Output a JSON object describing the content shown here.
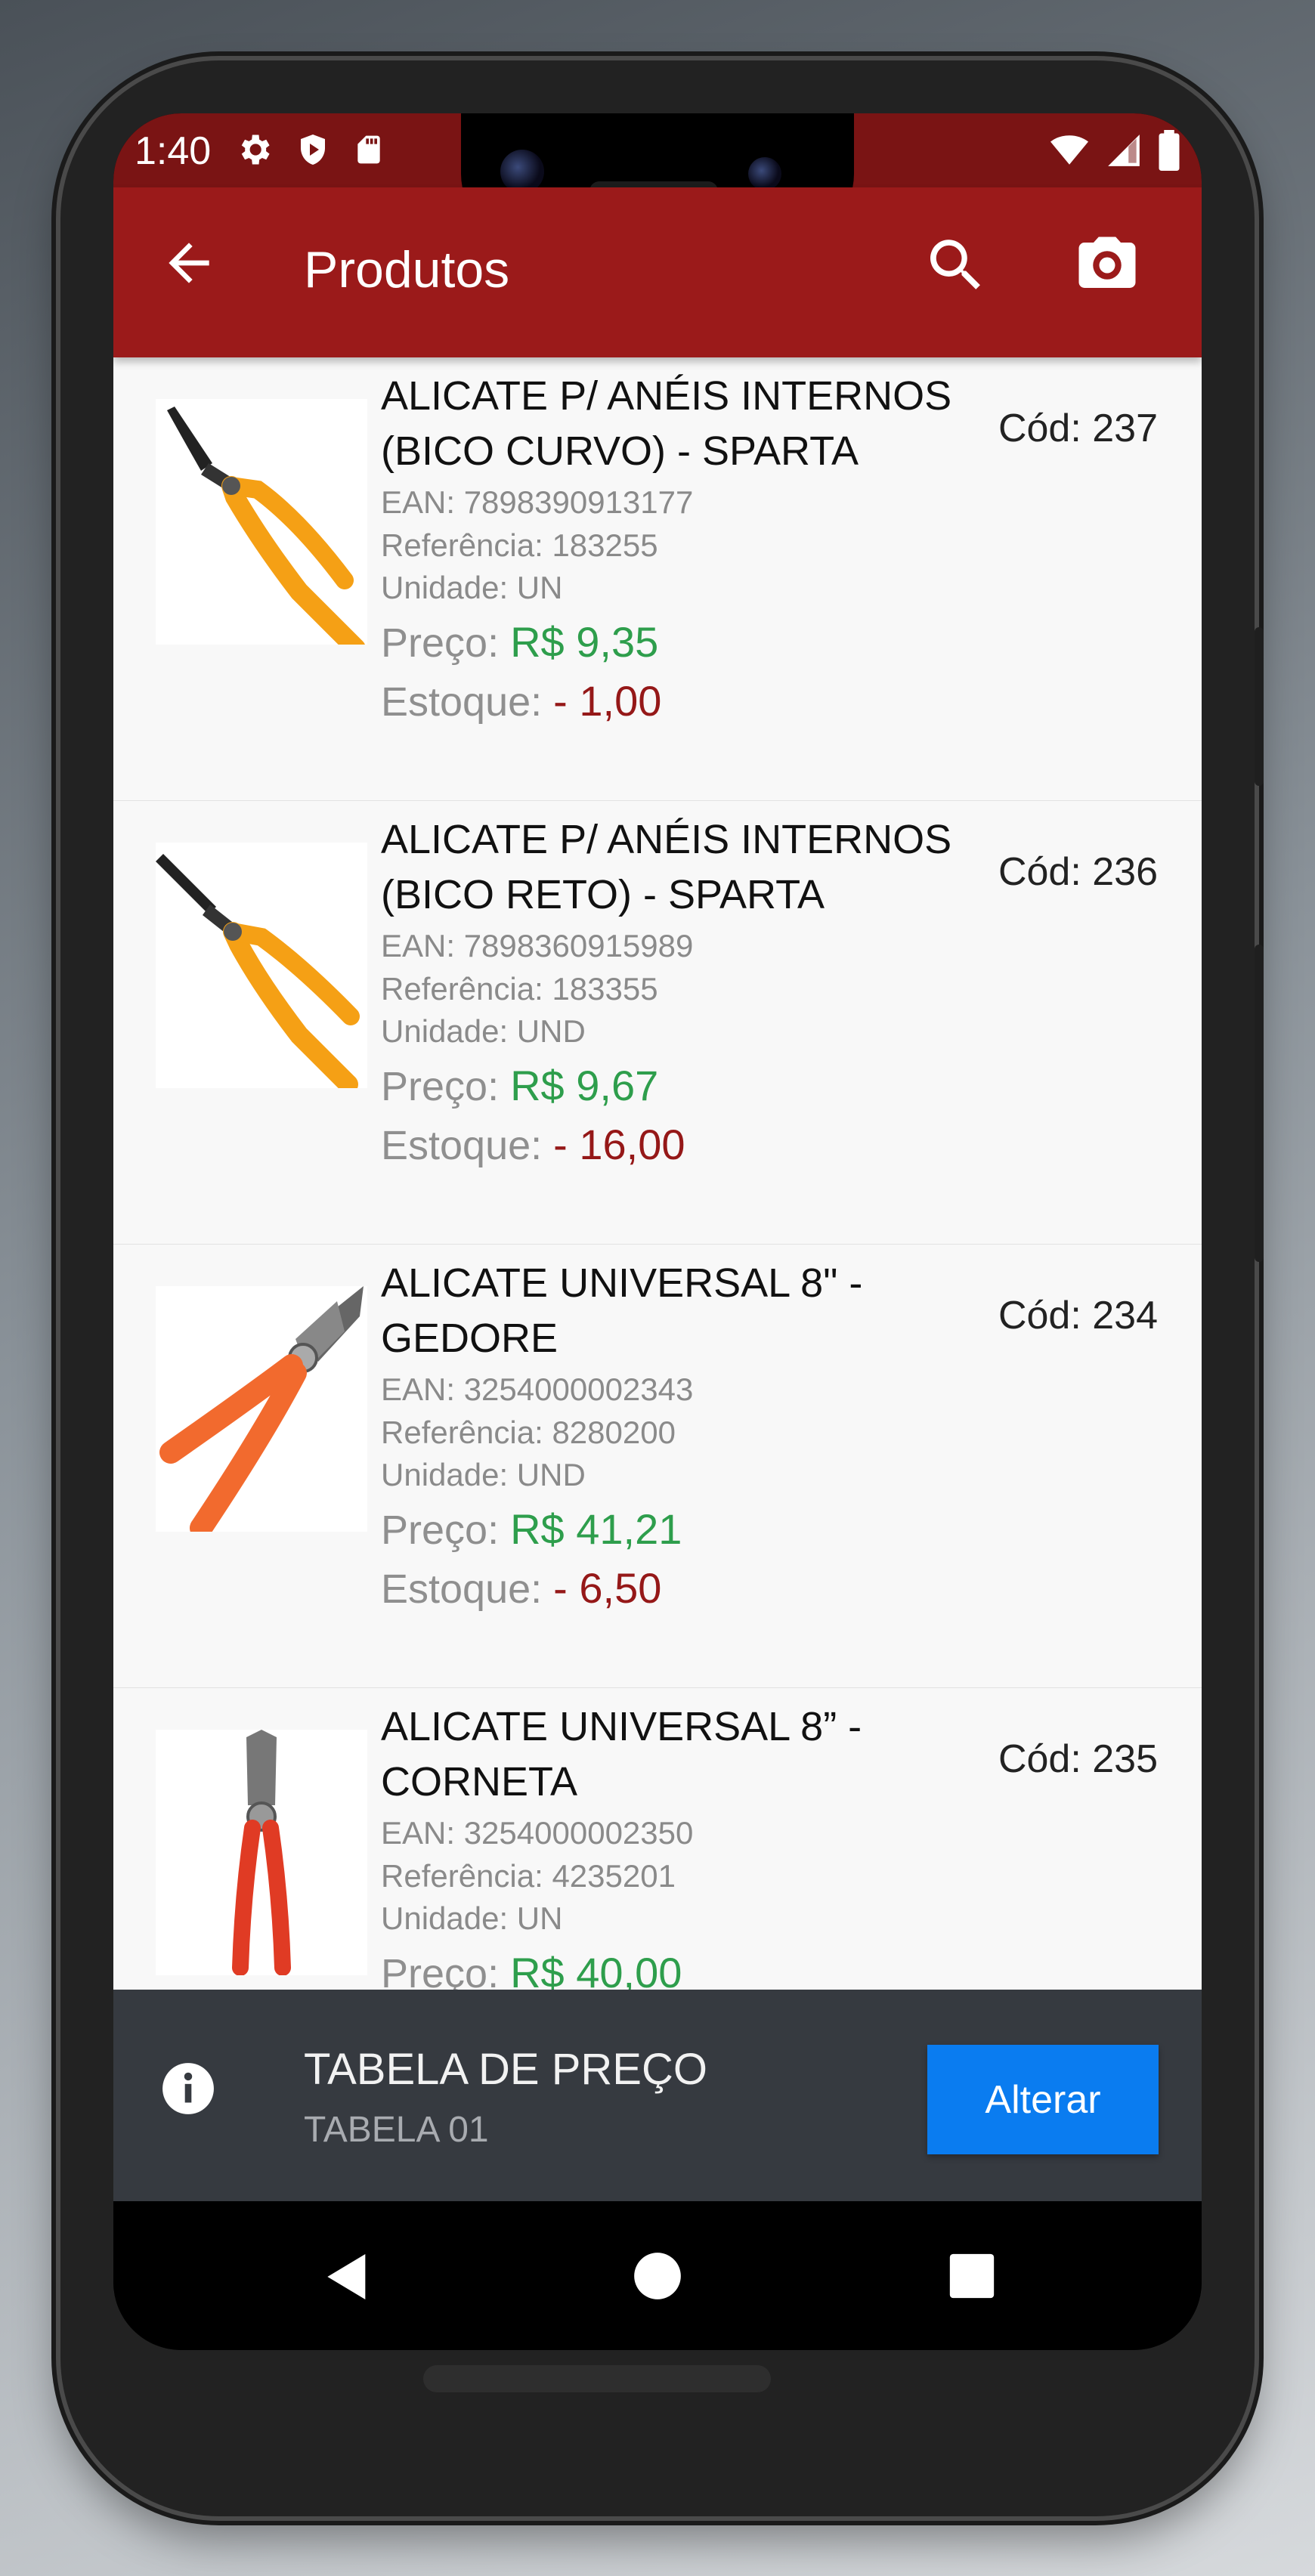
{
  "status_bar": {
    "time": "1:40"
  },
  "app_bar": {
    "title": "Produtos"
  },
  "products": [
    {
      "name": "ALICATE P/ ANÉIS INTERNOS (BICO CURVO) - SPARTA",
      "code": "Cód: 237",
      "ean": "EAN: 7898390913177",
      "reference": "Referência: 183255",
      "unit": "Unidade: UN",
      "price_label": "Preço:",
      "price": "R$ 9,35",
      "stock_label": "Estoque:",
      "stock": "- 1,00",
      "image_icon": "curved-snap-ring-pliers"
    },
    {
      "name": "ALICATE P/ ANÉIS INTERNOS (BICO RETO) - SPARTA",
      "code": "Cód: 236",
      "ean": "EAN: 7898360915989",
      "reference": "Referência: 183355",
      "unit": "Unidade: UND",
      "price_label": "Preço:",
      "price": "R$ 9,67",
      "stock_label": "Estoque:",
      "stock": "- 16,00",
      "image_icon": "straight-snap-ring-pliers"
    },
    {
      "name": "ALICATE UNIVERSAL 8\" - GEDORE",
      "code": "Cód: 234",
      "ean": "EAN: 3254000002343",
      "reference": "Referência: 8280200",
      "unit": "Unidade: UND",
      "price_label": "Preço:",
      "price": "R$ 41,21",
      "stock_label": "Estoque:",
      "stock": "- 6,50",
      "image_icon": "universal-pliers-orange"
    },
    {
      "name": "ALICATE UNIVERSAL 8” - CORNETA",
      "code": "Cód: 235",
      "ean": "EAN: 3254000002350",
      "reference": "Referência: 4235201",
      "unit": "Unidade: UN",
      "price_label": "Preço:",
      "price": "R$ 40,00",
      "image_icon": "universal-pliers-red"
    }
  ],
  "price_table": {
    "title": "TABELA DE PREÇO",
    "value": "TABELA 01",
    "button_label": "Alterar"
  },
  "colors": {
    "status_bar": "#7a1414",
    "app_bar": "#9b1a1a",
    "price": "#2e9e4c",
    "stock": "#951818",
    "bottom_bar": "#363a40",
    "accent_button": "#0a7cf0"
  }
}
